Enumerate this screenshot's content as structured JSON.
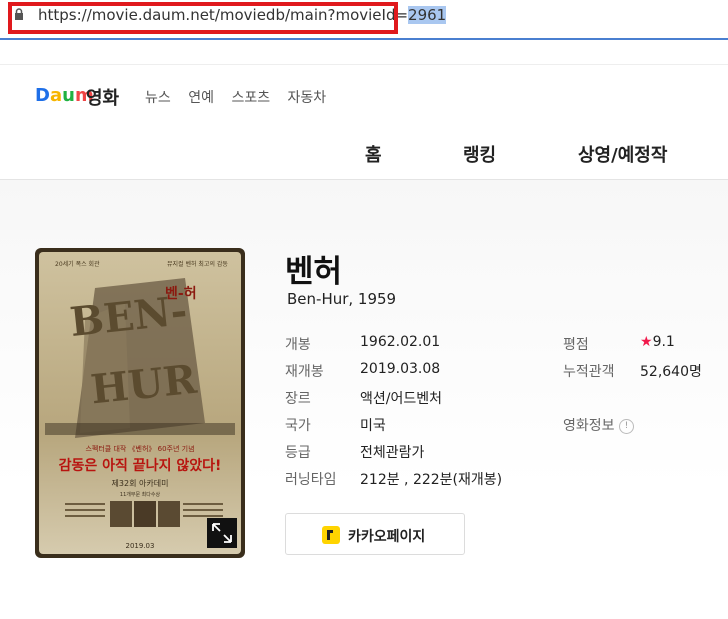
{
  "browser": {
    "url_prefix": "https://movie.daum.net/moviedb/main?movieId=",
    "url_selected": "2961"
  },
  "header": {
    "logo": "Daum",
    "section": "영화",
    "nav": [
      "뉴스",
      "연예",
      "스포츠",
      "자동차"
    ]
  },
  "tabs": [
    "홈",
    "랭킹",
    "상영/예정작"
  ],
  "movie": {
    "title": "벤허",
    "original_title": "Ben-Hur, 1959",
    "details": [
      {
        "label": "개봉",
        "value": "1962.02.01"
      },
      {
        "label": "재개봉",
        "value": "2019.03.08"
      },
      {
        "label": "장르",
        "value": "액션/어드벤처"
      },
      {
        "label": "국가",
        "value": "미국"
      },
      {
        "label": "등급",
        "value": "전체관람가"
      },
      {
        "label": "러닝타임",
        "value": "212분 , 222분(재개봉)"
      }
    ],
    "rating_label": "평점",
    "rating_value": "9.1",
    "audience_label": "누적관객",
    "audience_value": "52,640명",
    "info_label": "영화정보",
    "kakao_button": "카카오페이지"
  },
  "poster": {
    "top_left": "20세기 폭스 회관 ",
    "top_right": "뮤지컬 벤허 최고의 감동",
    "big_title": "BEN-HUR",
    "korean_title": "벤-허",
    "banner_line1": "스펙터클 대작 《벤허》 60주년 기념",
    "banner_line2": "감동은 아직 끝나지 않았다!",
    "award": "제32회 아카데미",
    "award_sub": "11개부문 최다수상",
    "date": "2019.03"
  },
  "colors": {
    "accent_red": "#e0191d",
    "star": "#f1194b",
    "kakao_yellow": "#ffd400"
  }
}
